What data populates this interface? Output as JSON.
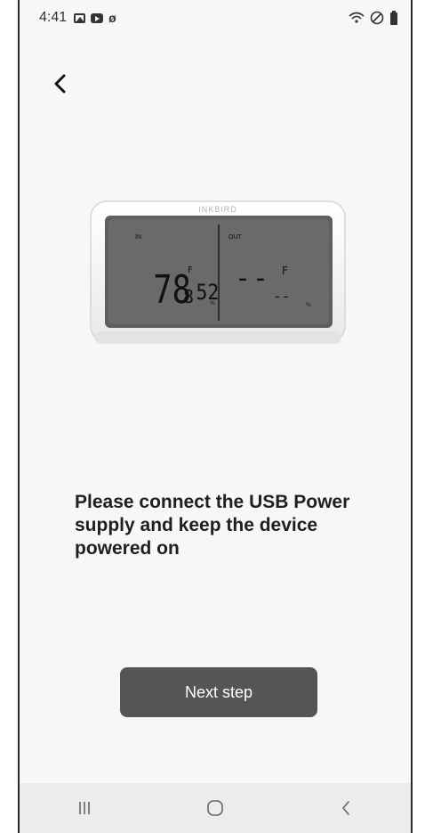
{
  "status_bar": {
    "time": "4:41",
    "left_icons": [
      "gallery-icon",
      "youtube-icon",
      "rotate-icon"
    ],
    "right_icons": [
      "wifi-icon",
      "do-not-disturb-icon",
      "battery-icon"
    ]
  },
  "header": {
    "back_icon": "chevron-left-icon"
  },
  "device": {
    "brand": "INKBIRD",
    "in_label": "IN",
    "out_label": "OUT",
    "in_temp": "78",
    "in_temp_unit": "F",
    "in_decimal": "8",
    "in_humidity": "52",
    "in_humidity_unit": "%",
    "out_temp": "--",
    "out_temp_unit": "F",
    "out_humidity": "--",
    "out_humidity_unit": "%"
  },
  "instruction": {
    "text": "Please connect the USB Power supply and keep the device powered on"
  },
  "actions": {
    "next_label": "Next step"
  },
  "nav_bar": {
    "items": [
      "recent-apps-icon",
      "home-icon",
      "back-icon"
    ]
  },
  "colors": {
    "button_bg": "#555555",
    "page_bg": "#f7f7f7",
    "lcd_bg": "#6a6a6a"
  }
}
